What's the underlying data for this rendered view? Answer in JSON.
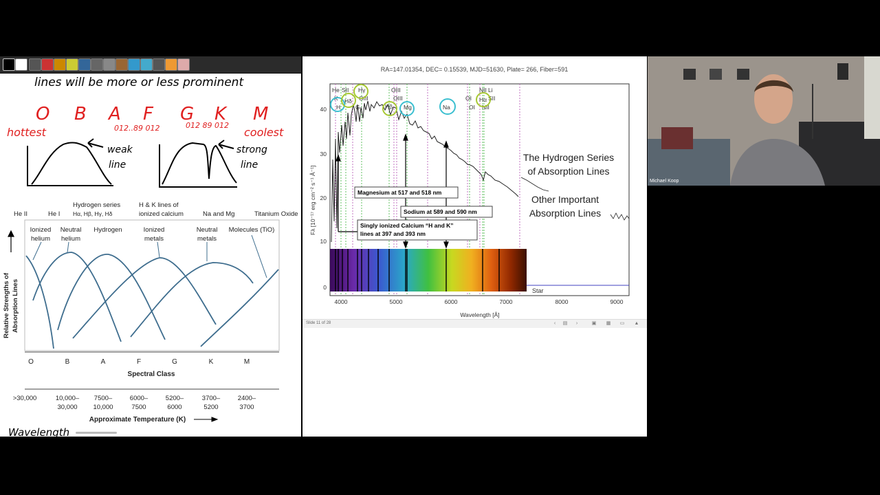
{
  "notes": {
    "top_text": "lines will be more or less prominent",
    "spectral_letters": [
      "O",
      "B",
      "A",
      "F",
      "G",
      "K",
      "M"
    ],
    "hottest": "hottest",
    "coolest": "coolest",
    "subclass_a": "012..89 012",
    "subclass_b": "012 89 012",
    "weak_label_1": "weak",
    "weak_label_2": "line",
    "strong_label_1": "strong",
    "strong_label_2": "line"
  },
  "absorption_chart": {
    "top_labels": [
      "He II",
      "He I",
      "Hydrogen series",
      "H & K lines of",
      "Na and Mg",
      "Titanium Oxide"
    ],
    "top_labels_sub": [
      "Hα, Hβ, Hγ, Hδ",
      "ionized calcium"
    ],
    "curve_labels": [
      [
        "Ionized",
        "helium"
      ],
      [
        "Neutral",
        "helium"
      ],
      [
        "Hydrogen"
      ],
      [
        "Ionized",
        "metals"
      ],
      [
        "Neutral",
        "metals"
      ],
      [
        "Molecules (TiO)"
      ]
    ],
    "ylabel_1": "Relative Strengths of",
    "ylabel_2": "Absorption Lines",
    "classes": [
      "O",
      "B",
      "A",
      "F",
      "G",
      "K",
      "M"
    ],
    "xlabel": "Spectral Class",
    "temps_top": [
      ">30,000",
      "10,000–",
      "7500–",
      "6000–",
      "5200–",
      "3700–",
      "2400–"
    ],
    "temps_bottom": [
      "",
      "30,000",
      "10,000",
      "7500",
      "6000",
      "5200",
      "3700"
    ],
    "temp_label": "Approximate Temperature (K)",
    "cutoff_text": "Wavelength"
  },
  "spectrum": {
    "header": "RA=147.01354, DEC= 0.15539, MJD=51630, Plate= 266, Fiber=591",
    "ylabel": "Fλ [10⁻¹⁷ erg cm⁻² s⁻¹ Å⁻¹]",
    "xlabel": "Wavelength [Å]",
    "x_ticks": [
      "4000",
      "5000",
      "6000",
      "7000",
      "8000",
      "9000"
    ],
    "y_ticks": [
      "0",
      "10",
      "20",
      "30",
      "40"
    ],
    "line_ids_top": [
      "He",
      "SII",
      "Hγ",
      "OIII",
      "NII",
      "Li"
    ],
    "line_ids_mid": [
      "K",
      "Hδ",
      "OIII",
      "Hβ",
      "Mg",
      "Na",
      "OI",
      "Hα",
      "SII"
    ],
    "line_ids_low": [
      "H",
      "G",
      "OI",
      "NII"
    ],
    "callout_mg": "Magnesium at 517 and 518 nm",
    "callout_na": "Sodium at 589 and 590 nm",
    "callout_ca_1": "Singly ionized Calcium “H and K”",
    "callout_ca_2": "lines at 397 and 393 nm",
    "note_h_1": "The Hydrogen Series",
    "note_h_2": "of Absorption Lines",
    "note_o_1": "Other Important",
    "note_o_2": "Absorption Lines",
    "star_label": "Star",
    "slide_indicator": "Slide 11 of 28"
  },
  "webcam": {
    "name": "Michael Koop"
  },
  "colors": {
    "hand_red": "#e02020",
    "circle_blue": "#3bbfd0",
    "circle_green": "#a6c832",
    "curve_blue": "#3e6d8e"
  }
}
